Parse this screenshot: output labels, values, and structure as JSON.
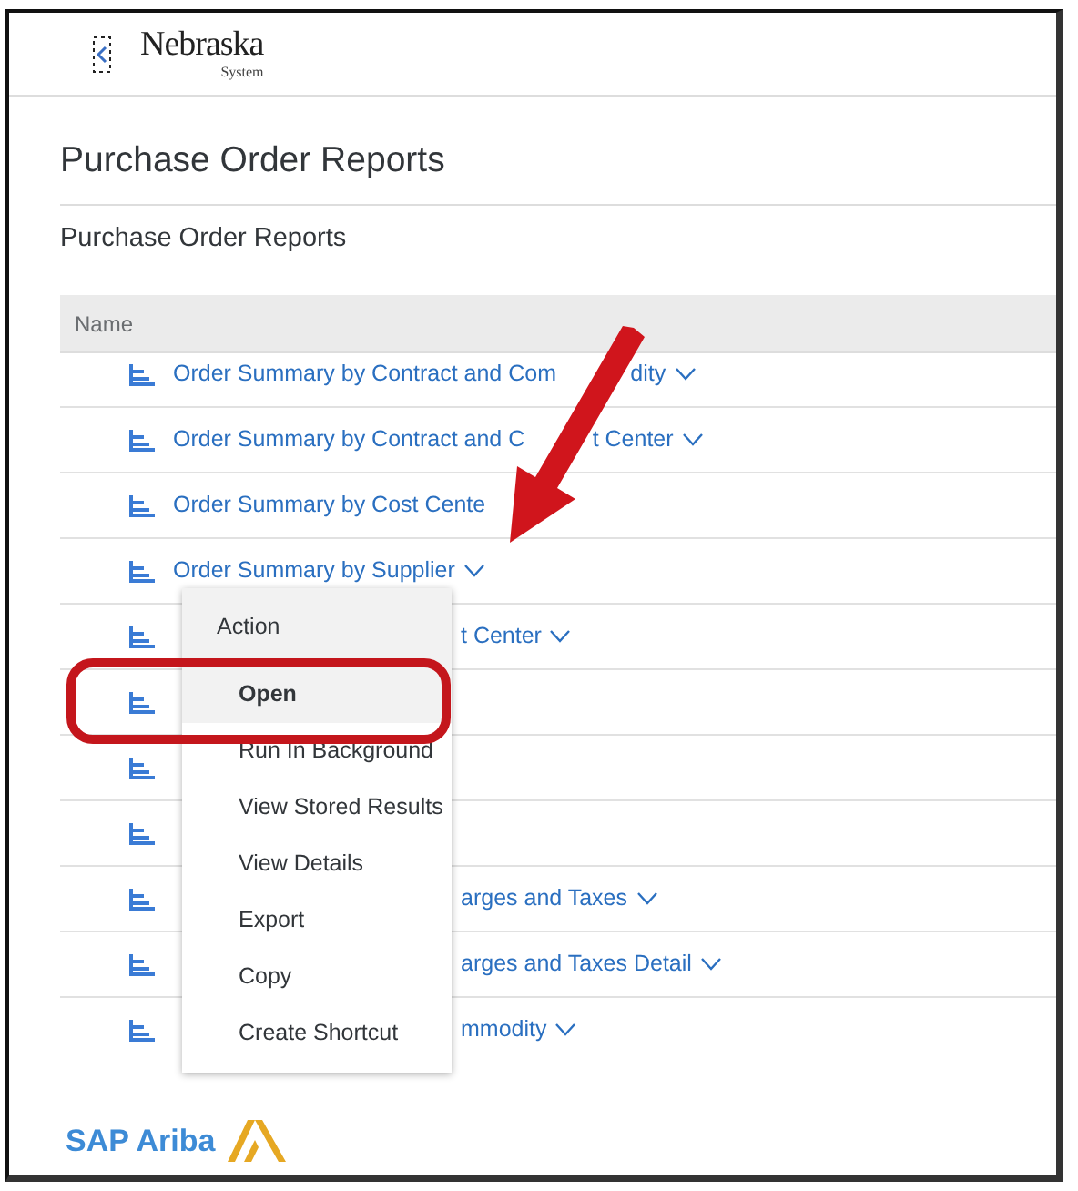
{
  "header": {
    "logo_name": "Nebraska",
    "logo_sub": "System"
  },
  "page_title": "Purchase Order Reports",
  "section_title": "Purchase Order Reports",
  "table": {
    "columns": [
      "Name"
    ],
    "rows": [
      {
        "name": "Order Summary by Contract and Com",
        "name_tail": "dity",
        "chevron": true,
        "covered": false
      },
      {
        "name": "Order Summary by Contract and C",
        "name_tail": "t Center",
        "chevron": true,
        "covered": false
      },
      {
        "name": "Order Summary by Cost Cente",
        "chevron": false,
        "covered": false
      },
      {
        "name": "Order Summary by Supplier",
        "chevron": true,
        "covered": false
      },
      {
        "name": "t Center",
        "chevron": true,
        "covered": true
      },
      {},
      {},
      {},
      {
        "name": "arges and Taxes",
        "chevron": true,
        "covered": true
      },
      {
        "name": "arges and Taxes Detail",
        "chevron": true,
        "covered": true
      },
      {
        "name": "mmodity",
        "chevron": true,
        "covered": true
      }
    ]
  },
  "menu": {
    "title": "Action",
    "items": [
      {
        "label": "Open",
        "selected": true
      },
      {
        "label": "Run In Background",
        "selected": false
      },
      {
        "label": "View Stored Results",
        "selected": false
      },
      {
        "label": "View Details",
        "selected": false
      },
      {
        "label": "Export",
        "selected": false
      },
      {
        "label": "Copy",
        "selected": false
      },
      {
        "label": "Create Shortcut",
        "selected": false
      }
    ]
  },
  "footer": {
    "brand": "SAP Ariba"
  }
}
